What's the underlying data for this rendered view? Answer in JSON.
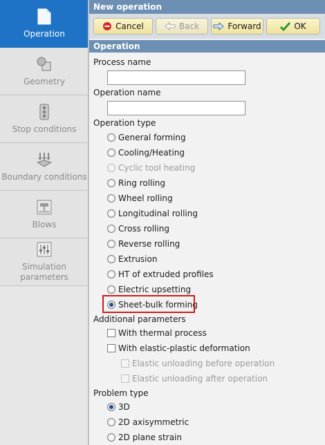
{
  "sidebar": {
    "items": [
      {
        "label": "Operation",
        "icon": "document-icon",
        "active": true
      },
      {
        "label": "Geometry",
        "icon": "geometry-icon",
        "active": false
      },
      {
        "label": "Stop conditions",
        "icon": "traffic-light-icon",
        "active": false
      },
      {
        "label": "Boundary conditions",
        "icon": "boundary-arrows-icon",
        "active": false
      },
      {
        "label": "Blows",
        "icon": "hammer-icon",
        "active": false
      },
      {
        "label": "Simulation parameters",
        "icon": "sliders-icon",
        "active": false
      }
    ]
  },
  "header": {
    "title": "New operation"
  },
  "toolbar": {
    "cancel_label": "Cancel",
    "back_label": "Back",
    "forward_label": "Forward",
    "ok_label": "OK"
  },
  "section": {
    "title": "Operation"
  },
  "form": {
    "process_name_label": "Process name",
    "process_name_value": "",
    "operation_name_label": "Operation name",
    "operation_name_value": "",
    "operation_type_label": "Operation type",
    "operation_types": [
      {
        "label": "General forming",
        "selected": false,
        "disabled": false
      },
      {
        "label": "Cooling/Heating",
        "selected": false,
        "disabled": false
      },
      {
        "label": "Cyclic tool heating",
        "selected": false,
        "disabled": true
      },
      {
        "label": "Ring rolling",
        "selected": false,
        "disabled": false
      },
      {
        "label": "Wheel rolling",
        "selected": false,
        "disabled": false
      },
      {
        "label": "Longitudinal rolling",
        "selected": false,
        "disabled": false
      },
      {
        "label": "Cross rolling",
        "selected": false,
        "disabled": false
      },
      {
        "label": "Reverse rolling",
        "selected": false,
        "disabled": false
      },
      {
        "label": "Extrusion",
        "selected": false,
        "disabled": false
      },
      {
        "label": "HT of extruded profiles",
        "selected": false,
        "disabled": false
      },
      {
        "label": "Electric upsetting",
        "selected": false,
        "disabled": false
      },
      {
        "label": "Sheet-bulk forming",
        "selected": true,
        "disabled": false
      }
    ],
    "additional_label": "Additional parameters",
    "thermal_label": "With thermal process",
    "elastic_label": "With elastic-plastic deformation",
    "unload_before_label": "Elastic unloading before operation",
    "unload_after_label": "Elastic unloading after operation",
    "problem_type_label": "Problem type",
    "problem_types": [
      {
        "label": "3D",
        "selected": true
      },
      {
        "label": "2D axisymmetric",
        "selected": false
      },
      {
        "label": "2D plane strain",
        "selected": false
      }
    ]
  },
  "colors": {
    "accent": "#1e73c6",
    "header": "#6c8fb3",
    "highlight": "#c81e1e"
  }
}
